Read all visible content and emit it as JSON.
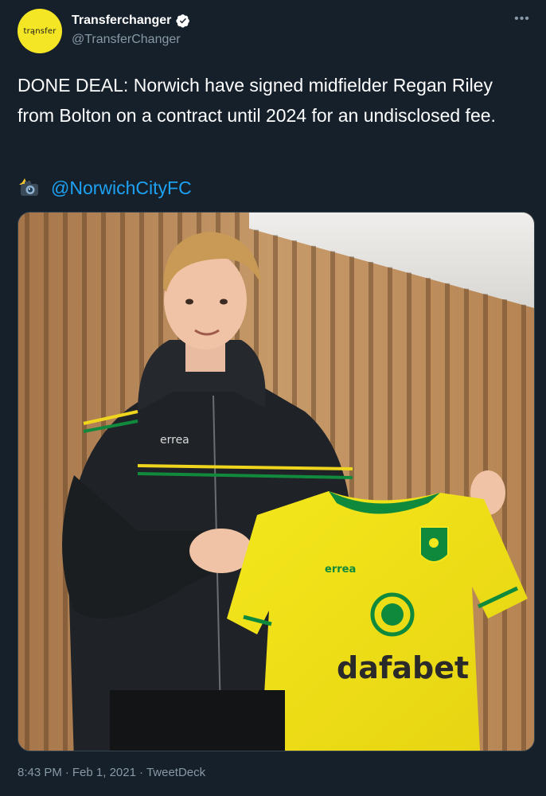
{
  "tweet": {
    "author": {
      "display_name": "Transferchanger",
      "handle": "@TransferChanger",
      "avatar_text": "trąnsfer",
      "verified": true
    },
    "more_label": "•••",
    "text": "DONE DEAL: Norwich have signed midfielder Regan Riley from Bolton on a contract until 2024 for an undisclosed fee.",
    "credit": {
      "icon": "camera-flash-icon",
      "mention": "@NorwichCityFC"
    },
    "image": {
      "jacket_brand": "errea",
      "shirt_brand": "errea",
      "shirt_sponsor": "dafabet"
    },
    "meta": {
      "time": "8:43 PM",
      "separator": "·",
      "date": "Feb 1, 2021",
      "source": "TweetDeck"
    }
  },
  "colors": {
    "background": "#15202b",
    "link": "#1da1f2",
    "muted": "#8899a6",
    "verified": "#ffffff",
    "avatar": "#f5e625",
    "shirt_yellow": "#f2e21a",
    "shirt_green": "#0f8a3c"
  }
}
